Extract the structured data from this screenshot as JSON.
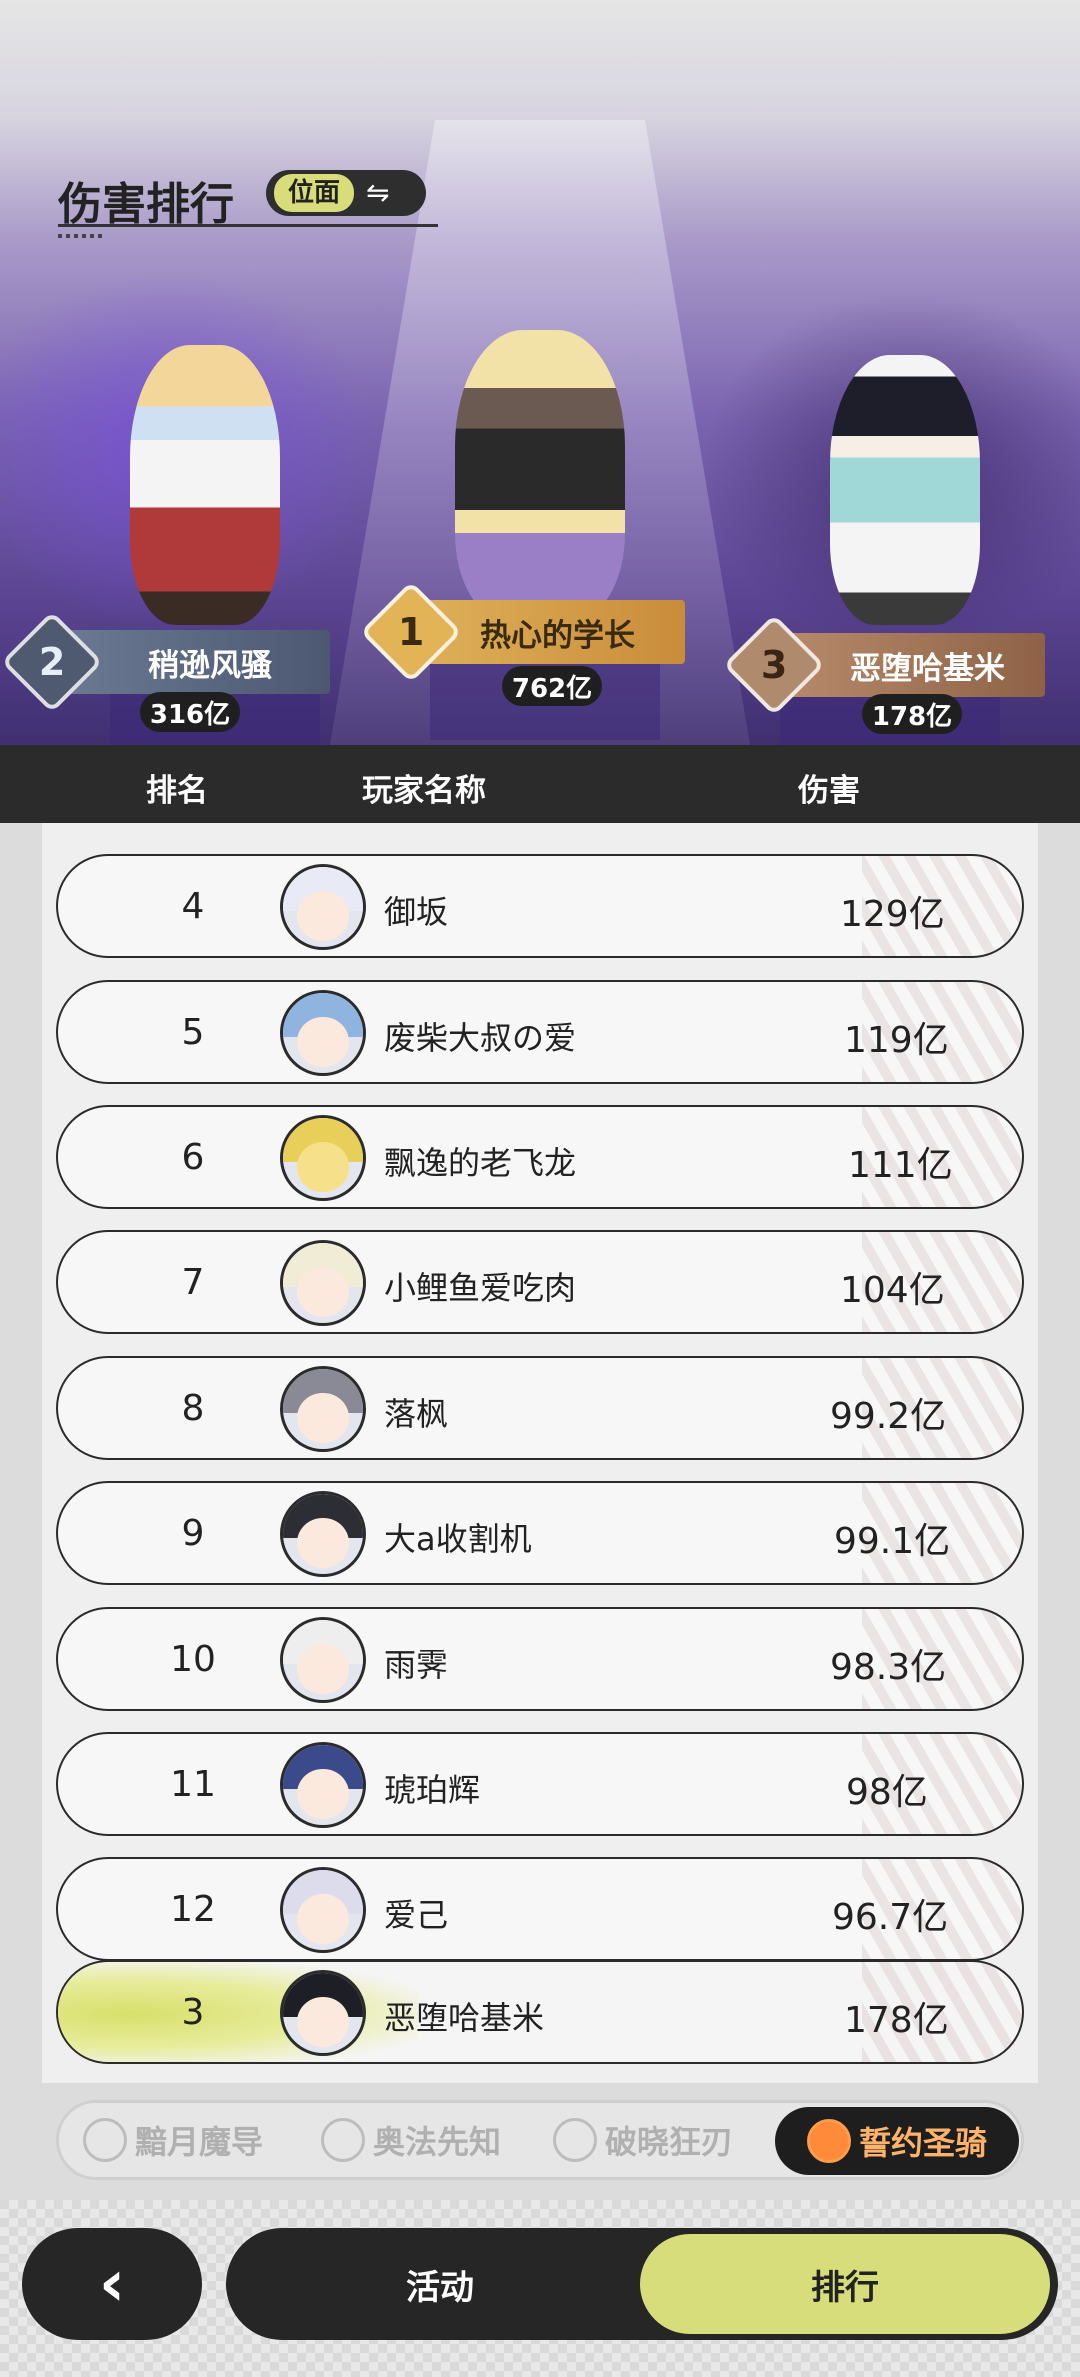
{
  "header": {
    "title": "伤害排行",
    "mode_label": "位面",
    "swap_icon": "swap-icon"
  },
  "podium": [
    {
      "rank": "2",
      "name": "稍逊风骚",
      "damage": "316亿"
    },
    {
      "rank": "1",
      "name": "热心的学长",
      "damage": "762亿"
    },
    {
      "rank": "3",
      "name": "恶堕哈基米",
      "damage": "178亿"
    }
  ],
  "table_header": {
    "rank": "排名",
    "player": "玩家名称",
    "damage": "伤害"
  },
  "rows": [
    {
      "rank": "4",
      "name": "御坂",
      "damage": "129亿"
    },
    {
      "rank": "5",
      "name": "废柴大叔の爱",
      "damage": "119亿"
    },
    {
      "rank": "6",
      "name": "飘逸的老飞龙",
      "damage": "111亿"
    },
    {
      "rank": "7",
      "name": "小鲤鱼爱吃肉",
      "damage": "104亿"
    },
    {
      "rank": "8",
      "name": "落枫",
      "damage": "99.2亿"
    },
    {
      "rank": "9",
      "name": "大a收割机",
      "damage": "99.1亿"
    },
    {
      "rank": "10",
      "name": "雨霁",
      "damage": "98.3亿"
    },
    {
      "rank": "11",
      "name": "琥珀辉",
      "damage": "98亿"
    },
    {
      "rank": "12",
      "name": "爱己",
      "damage": "96.7亿"
    }
  ],
  "self_row": {
    "rank": "3",
    "name": "恶堕哈基米",
    "damage": "178亿"
  },
  "class_tabs": [
    {
      "label": "黯月魔导",
      "active": false
    },
    {
      "label": "奥法先知",
      "active": false
    },
    {
      "label": "破晓狂刃",
      "active": false
    },
    {
      "label": "誓约圣骑",
      "active": true
    }
  ],
  "bottom_nav": {
    "back_icon": "chevron-left-icon",
    "activity_label": "活动",
    "ranking_label": "排行"
  },
  "colors": {
    "accent": "#d6dd7a",
    "dark": "#262626",
    "active_class": "#ffb36a"
  }
}
